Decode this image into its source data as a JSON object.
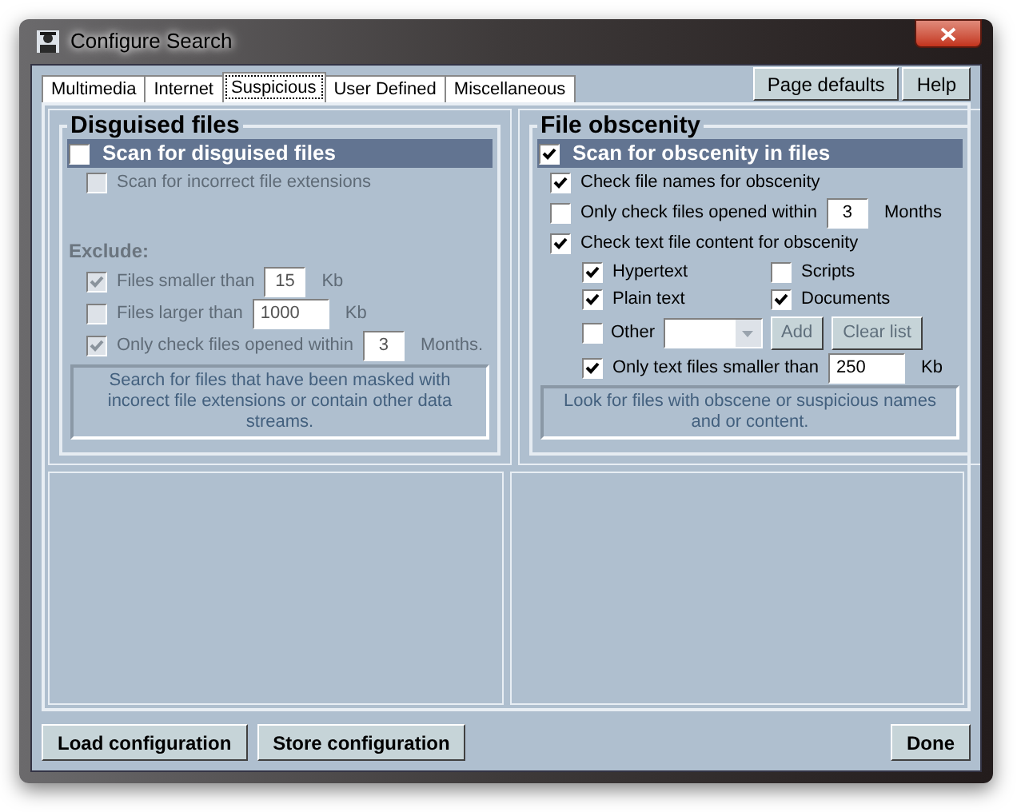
{
  "window": {
    "title": "Configure Search"
  },
  "tabs": [
    {
      "label": "Multimedia",
      "selected": false
    },
    {
      "label": "Internet",
      "selected": false
    },
    {
      "label": "Suspicious",
      "selected": true
    },
    {
      "label": "User Defined",
      "selected": false
    },
    {
      "label": "Miscellaneous",
      "selected": false
    }
  ],
  "header_buttons": [
    "Page defaults",
    "Help"
  ],
  "left_panel": {
    "title": "Disguised files",
    "main": {
      "label": "Scan for disguised files",
      "checked": false
    },
    "options": [
      {
        "kind": "check",
        "label": "Scan for incorrect file extensions",
        "checked": false,
        "disabled": true
      }
    ],
    "exclude_label": "Exclude:",
    "exclude": [
      {
        "kind": "check_value",
        "label": "Files smaller than",
        "checked": true,
        "disabled": true,
        "value": "15",
        "unit": "Kb"
      },
      {
        "kind": "check_value",
        "label": "Files larger than",
        "checked": false,
        "disabled": true,
        "value": "1000",
        "unit": "Kb"
      },
      {
        "kind": "check_value",
        "label": "Only check files opened within",
        "checked": true,
        "disabled": true,
        "value": "3",
        "unit": "Months."
      }
    ],
    "description": "Search for files that have been masked with incorect file extensions or contain other data streams."
  },
  "right_panel": {
    "title": "File obscenity",
    "main": {
      "label": "Scan for obscenity in files",
      "checked": true
    },
    "options": [
      {
        "kind": "check",
        "label": "Check file names for obscenity",
        "checked": true,
        "disabled": false
      },
      {
        "kind": "check_value",
        "label": "Only check files opened within",
        "checked": false,
        "disabled": false,
        "value": "3",
        "unit": "Months"
      },
      {
        "kind": "check",
        "label": "Check text file content for obscenity",
        "checked": true,
        "disabled": false,
        "children": [
          {
            "kind": "grid",
            "items": [
              {
                "label": "Hypertext",
                "checked": true
              },
              {
                "label": "Scripts",
                "checked": false
              },
              {
                "label": "Plain text",
                "checked": true
              },
              {
                "label": "Documents",
                "checked": true
              }
            ]
          },
          {
            "kind": "other",
            "label": "Other",
            "checked": false,
            "buttons": [
              {
                "label": "Add",
                "disabled": true
              },
              {
                "label": "Clear list",
                "disabled": true
              }
            ]
          },
          {
            "kind": "check_value",
            "label": "Only text files smaller than",
            "checked": true,
            "disabled": false,
            "value": "250",
            "unit": "Kb"
          }
        ]
      }
    ],
    "description": "Look for files with obscene or suspicious names and or content."
  },
  "footer_buttons": [
    {
      "label": "Load configuration"
    },
    {
      "label": "Store configuration"
    },
    {
      "label": "Done"
    }
  ]
}
